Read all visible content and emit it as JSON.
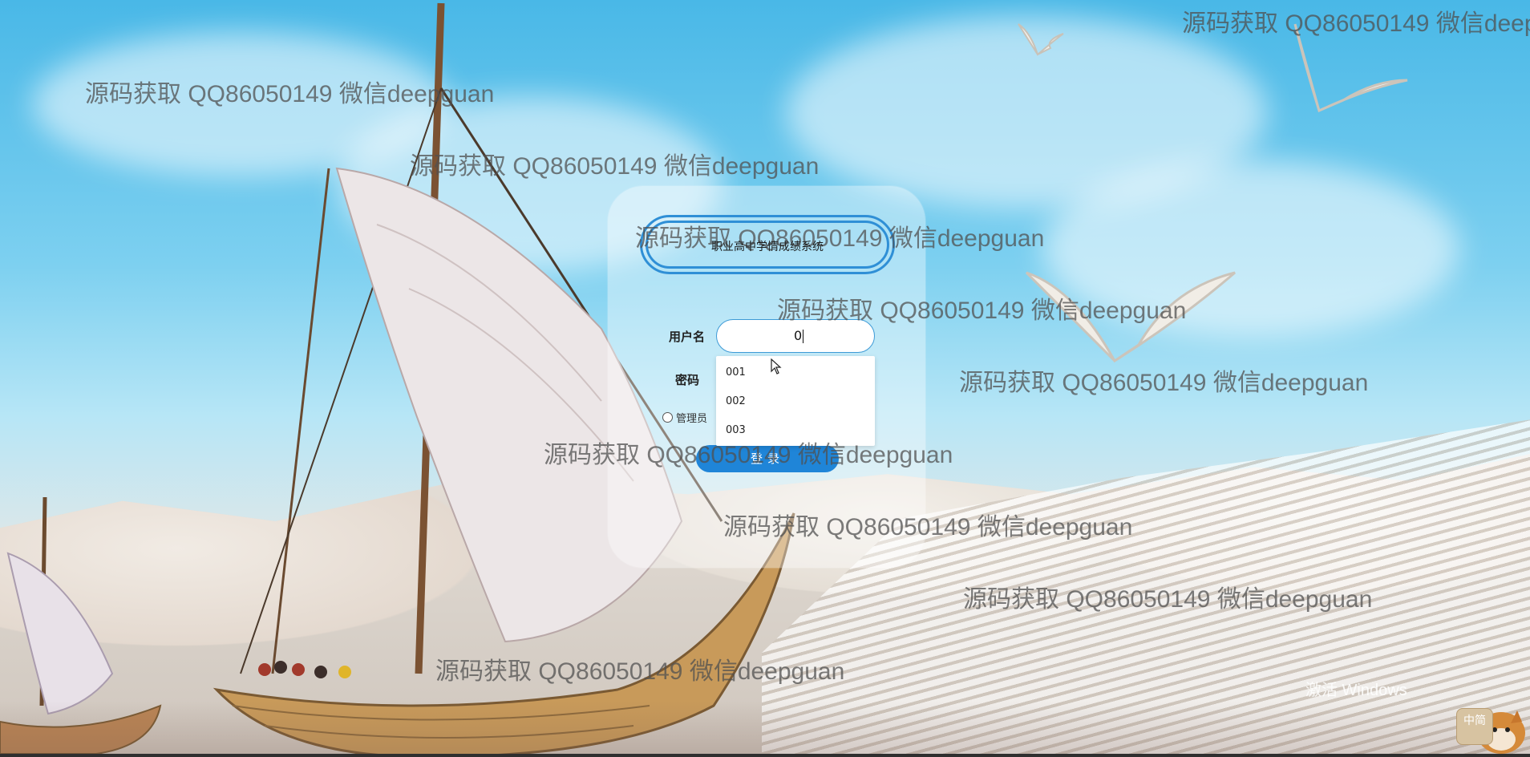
{
  "login": {
    "title": "职业高中学情成绩系统",
    "username_label": "用户名",
    "password_label": "密码",
    "username_value": "0",
    "autocomplete_options": [
      "001",
      "002",
      "003"
    ],
    "role_label": "管理员",
    "login_button": "登录"
  },
  "watermark": {
    "text": "源码获取 QQ86050149 微信deepguan"
  },
  "os": {
    "activate_title": "激活 Windows",
    "ime_label": "中简"
  },
  "colors": {
    "accent": "#1f85d8",
    "border": "#2f8fd6"
  },
  "icons": {
    "radio": "radio-icon",
    "cursor": "mouse-pointer-icon"
  }
}
